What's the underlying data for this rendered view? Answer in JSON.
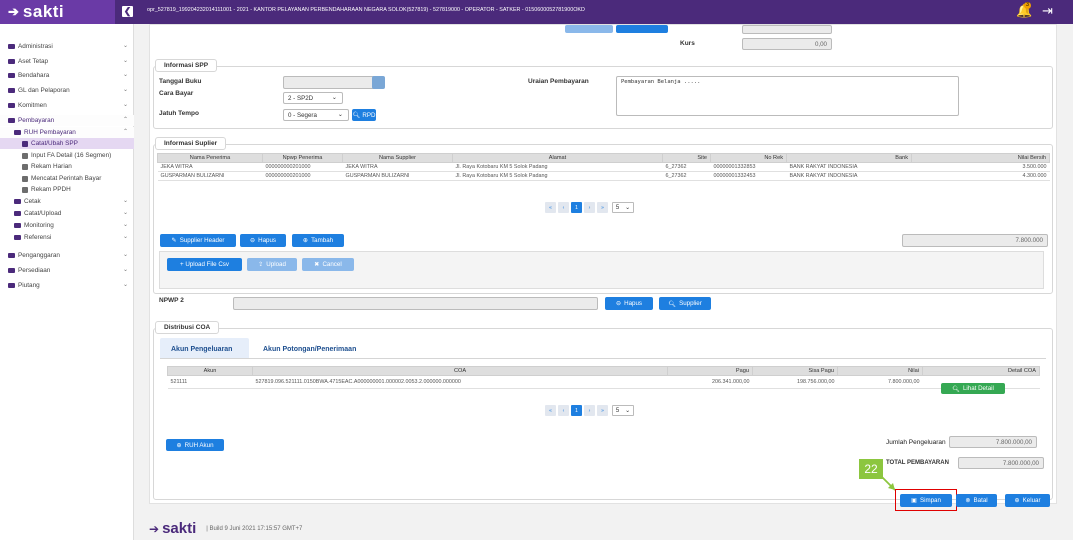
{
  "header": {
    "logo_icon": "sakti-arrow-icon",
    "logo_text": "sakti",
    "user_info": "opr_527819_199204232014111001 - 2021 - KANTOR PELAYANAN PERBENDAHARAAN NEGARA SOLOK(527819) - 527819000 - OPERATOR - SATKER - 0150600052781900OKD",
    "badge": "3"
  },
  "sidebar": {
    "items": [
      {
        "label": "Administrasi",
        "chevron": "⌄"
      },
      {
        "label": "Aset Tetap",
        "chevron": "⌄"
      },
      {
        "label": "Bendahara",
        "chevron": "⌄"
      },
      {
        "label": "GL dan Pelaporan",
        "chevron": "⌄"
      },
      {
        "label": "Komitmen",
        "chevron": "⌄"
      },
      {
        "label": "Pembayaran",
        "chevron": "⌃"
      },
      {
        "label": "RUH Pembayaran",
        "chevron": "⌃"
      },
      {
        "label": "Catat/Ubah SPP"
      },
      {
        "label": "Input FA Detail (16 Segmen)"
      },
      {
        "label": "Rekam Harian"
      },
      {
        "label": "Mencatat Perintah Bayar"
      },
      {
        "label": "Rekam PPDH"
      },
      {
        "label": "Cetak",
        "chevron": "⌄"
      },
      {
        "label": "Catat/Upload",
        "chevron": "⌄"
      },
      {
        "label": "Monitoring",
        "chevron": "⌄"
      },
      {
        "label": "Referensi",
        "chevron": "⌄"
      },
      {
        "label": "Penganggaran",
        "chevron": "⌄"
      },
      {
        "label": "Persediaan",
        "chevron": "⌄"
      },
      {
        "label": "Piutang",
        "chevron": "⌄"
      }
    ]
  },
  "top": {
    "kurs_label": "Kurs",
    "kurs_value": "0,00"
  },
  "spp": {
    "title": "Informasi SPP",
    "tanggal_buku_label": "Tanggal Buku",
    "tanggal_buku_value": "",
    "cara_bayar_label": "Cara Bayar",
    "cara_bayar_value": "2 - SP2D",
    "jatuh_tempo_label": "Jatuh Tempo",
    "jatuh_tempo_value": "0 - Segera",
    "rpd_button": "RPD",
    "uraian_label": "Uraian Pembayaran",
    "uraian_value": "Pembayaran Belanja ....."
  },
  "supplier": {
    "title": "Informasi Suplier",
    "columns": [
      "Nama Penerima",
      "Npwp Penerima",
      "Nama Supplier",
      "Alamat",
      "Site",
      "No Rek",
      "Bank",
      "Nilai Bersih"
    ],
    "rows": [
      [
        "JEKA WITRA",
        "000000000201000",
        "JEKA WITRA",
        "Jl. Raya Kotobaru KM 5 Solok Padang",
        "6_27362",
        "00000001332853",
        "BANK RAKYAT INDONESIA",
        "3.500.000"
      ],
      [
        "GUSPARMAN BULIZARNI",
        "000000000201000",
        "GUSPARMAN BULIZARNI",
        "Jl. Raya Kotobaru KM 5 Solok Padang",
        "6_27362",
        "00000001332453",
        "BANK RAKYAT INDONESIA",
        "4.300.000"
      ]
    ],
    "page": "1",
    "page_size": "5",
    "supplier_header_button": "Supplier Header",
    "hapus_button": "Hapus",
    "tambah_button": "Tambah",
    "total_value": "7.800.000",
    "upload_csv_button": "+ Upload File Csv",
    "upload_button": "Upload",
    "cancel_button": "Cancel",
    "npwp_label": "NPWP 2",
    "npwp_value": "",
    "npwp_hapus_button": "Hapus",
    "npwp_supplier_button": "Supplier"
  },
  "coa": {
    "title": "Distribusi COA",
    "tab_pengeluaran": "Akun Pengeluaran",
    "tab_potongan": "Akun Potongan/Penerimaan",
    "columns": [
      "Akun",
      "COA",
      "Pagu",
      "Sisa Pagu",
      "Nilai",
      "Detail COA"
    ],
    "rows": [
      [
        "521111",
        "527819.096.521111.0150BWA.4715EAC.A000000001.000002.0053.2.000000.000000",
        "206.341.000,00",
        "198.756.000,00",
        "7.800.000,00"
      ]
    ],
    "detail_button": "Lihat Detail",
    "page": "1",
    "page_size": "5",
    "ruh_akun_button": "RUH Akun",
    "jumlah_label": "Jumlah Pengeluaran",
    "jumlah_value": "7.800.000,00",
    "total_label": "TOTAL PEMBAYARAN",
    "total_value": "7.800.000,00"
  },
  "actions": {
    "step_badge": "22",
    "simpan_button": "Simpan",
    "batal_button": "Batal",
    "keluar_button": "Keluar"
  },
  "footer": {
    "logo_text": "sakti",
    "build": "| Build 9 Juni 2021 17:15:57 GMT+7"
  }
}
